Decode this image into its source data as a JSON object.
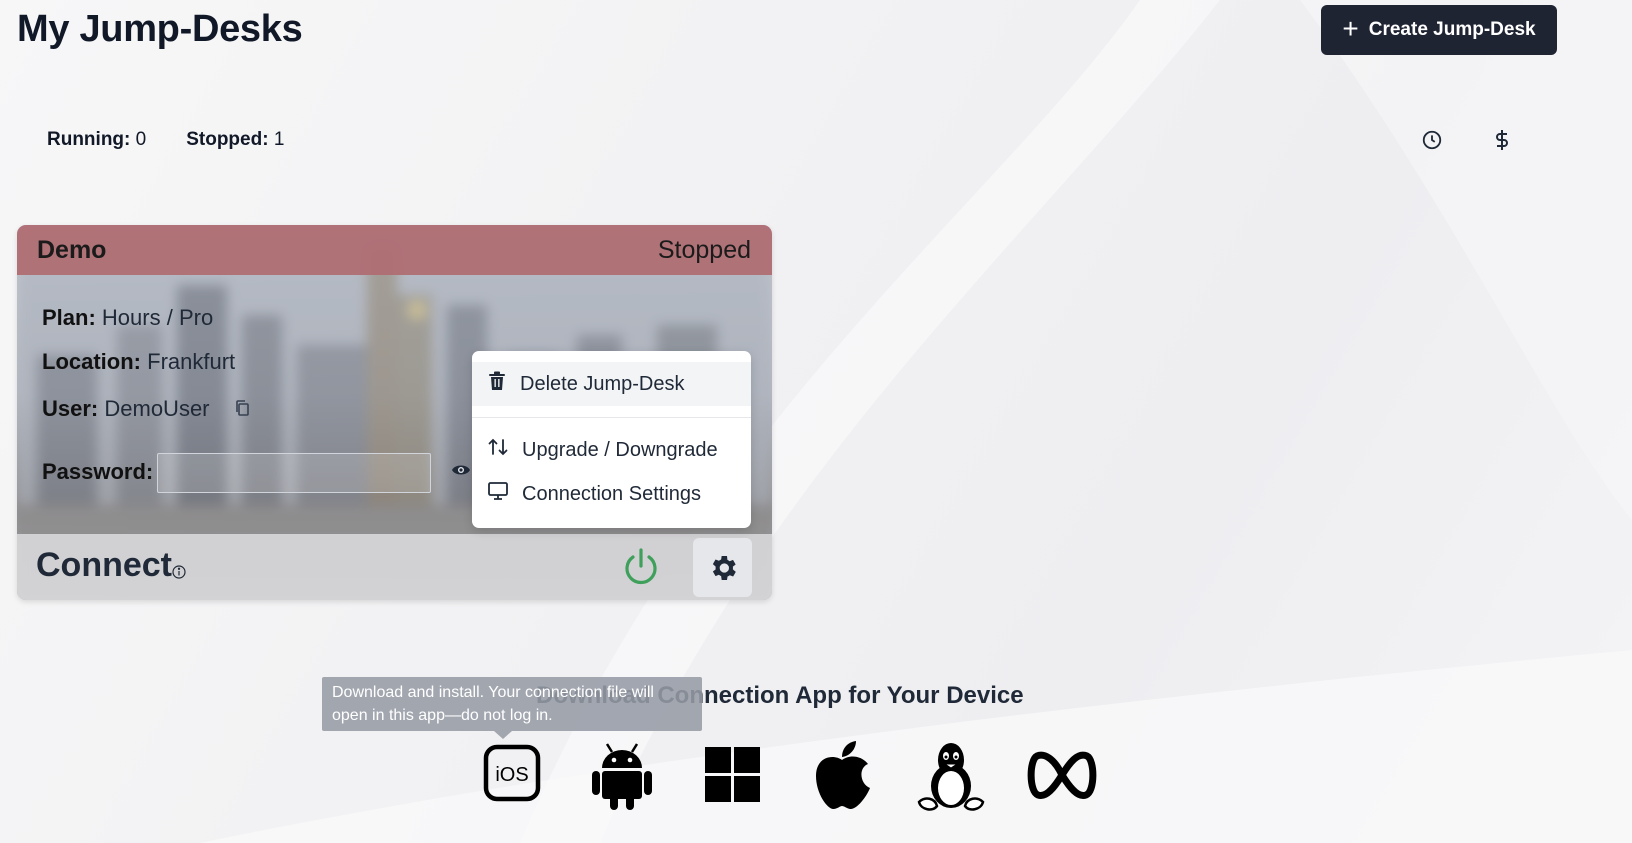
{
  "page": {
    "title": "My Jump-Desks"
  },
  "header": {
    "create_button_label": "Create Jump-Desk",
    "create_button_icon": "plus-icon"
  },
  "stats": {
    "running_label": "Running:",
    "running_value": "0",
    "stopped_label": "Stopped:",
    "stopped_value": "1",
    "icons": [
      "clock-icon",
      "dollar-icon"
    ]
  },
  "desk": {
    "name": "Demo",
    "status": "Stopped",
    "status_color": "#af6e73",
    "plan_label": "Plan:",
    "plan_value": "Hours / Pro",
    "location_label": "Location:",
    "location_value": "Frankfurt",
    "user_label": "User:",
    "user_value": "DemoUser",
    "password_label": "Password:",
    "password_value": "",
    "connect_label": "Connect",
    "power_color": "#3ea05a"
  },
  "menu": {
    "items": [
      {
        "label": "Delete Jump-Desk",
        "icon": "trash-icon"
      },
      {
        "label": "Upgrade / Downgrade",
        "icon": "arrows-up-down-icon"
      },
      {
        "label": "Connection Settings",
        "icon": "monitor-icon"
      }
    ]
  },
  "downloads": {
    "title": "Download Connection App for Your Device",
    "tooltip": "Download and install. Your connection file will open in this app—do not log in.",
    "platforms": [
      "ios-icon",
      "android-icon",
      "windows-icon",
      "apple-icon",
      "linux-icon",
      "meta-icon"
    ],
    "ios_label": "iOS"
  },
  "colors": {
    "primary_button": "#1f2433",
    "header_stopped": "#af6e73"
  }
}
